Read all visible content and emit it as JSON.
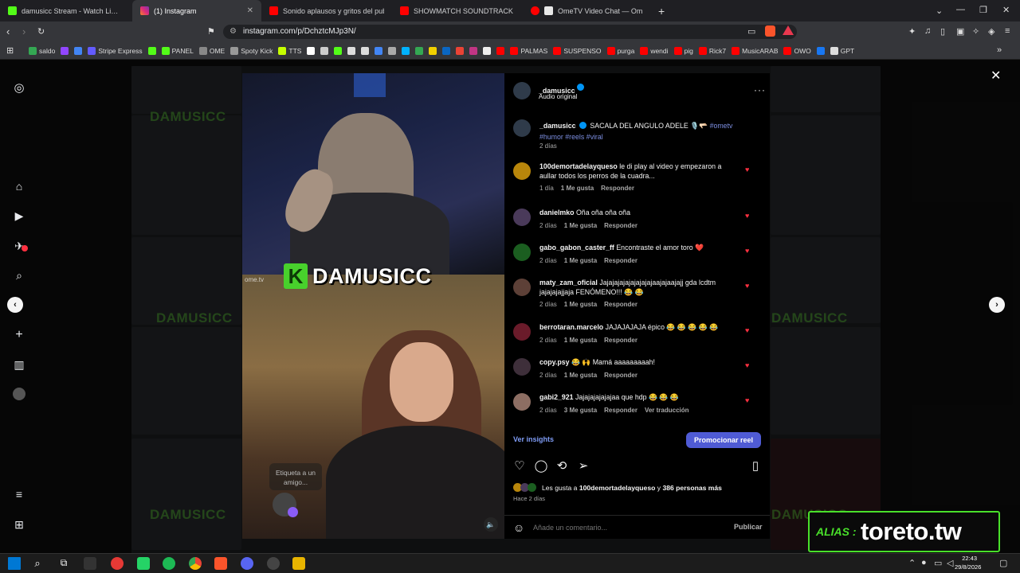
{
  "tabs": [
    {
      "title": "damusicc Stream - Watch Live on",
      "color": "#53fc18"
    },
    {
      "title": "(1) Instagram",
      "color": "#c13584",
      "active": true
    },
    {
      "title": "Sonido aplausos y gritos del publico",
      "color": "#ff0000"
    },
    {
      "title": "SHOWMATCH SOUNDTRACK - \"Risk",
      "color": "#ff0000"
    },
    {
      "title": "OmeTV Video Chat — Omegle R",
      "color": "#ff0000"
    }
  ],
  "address": {
    "url": "instagram.com/p/DchztcMJp3N/"
  },
  "bookmarks": [
    {
      "label": "saldo",
      "color": "#34a853"
    },
    {
      "label": "",
      "color": "#9146ff"
    },
    {
      "label": "",
      "color": "#4285f4"
    },
    {
      "label": "Stripe Express",
      "color": "#635bff"
    },
    {
      "label": "",
      "color": "#53fc18"
    },
    {
      "label": "PANEL",
      "color": "#53fc18"
    },
    {
      "label": "OME",
      "color": "#888888"
    },
    {
      "label": "Spoty Kick",
      "color": "#999999"
    },
    {
      "label": "TTS",
      "color": "#c6ff00"
    },
    {
      "label": "",
      "color": "#ffffff"
    },
    {
      "label": "",
      "color": "#cccccc"
    },
    {
      "label": "",
      "color": "#53fc18"
    },
    {
      "label": "",
      "color": "#dddddd"
    },
    {
      "label": "",
      "color": "#dddddd"
    },
    {
      "label": "",
      "color": "#4285f4"
    },
    {
      "label": "",
      "color": "#aaaaaa"
    },
    {
      "label": "",
      "color": "#00b2ff"
    },
    {
      "label": "",
      "color": "#34a853"
    },
    {
      "label": "",
      "color": "#f0d000"
    },
    {
      "label": "",
      "color": "#0a66c2"
    },
    {
      "label": "",
      "color": "#ea4335"
    },
    {
      "label": "",
      "color": "#c13584"
    },
    {
      "label": "",
      "color": "#eeeeee"
    },
    {
      "label": "",
      "color": "#ff0000"
    },
    {
      "label": "PALMAS",
      "color": "#ff0000"
    },
    {
      "label": "SUSPENSO",
      "color": "#ff0000"
    },
    {
      "label": "purga",
      "color": "#ff0000"
    },
    {
      "label": "wendi",
      "color": "#ff0000"
    },
    {
      "label": "pig",
      "color": "#ff0000"
    },
    {
      "label": "Rick7",
      "color": "#ff0000"
    },
    {
      "label": "MusicARAB",
      "color": "#ff0000"
    },
    {
      "label": "OWO",
      "color": "#ff0000"
    },
    {
      "label": "",
      "color": "#1877f2"
    },
    {
      "label": "GPT",
      "color": "#dddddd"
    }
  ],
  "video": {
    "brand_letter": "K",
    "brand_text": "DAMUSICC",
    "source_tag": "ome.tv",
    "tag_hint": "Etiqueta a un amigo..."
  },
  "collage_labels": [
    "DAMUSICC",
    "DAMUSICC",
    "DAMUSICC",
    "DAMUSICC",
    "DAMUSICC"
  ],
  "post": {
    "author": "_damusicc",
    "audio": "Audio original",
    "caption_user": "_damusicc",
    "caption": "SACALA DEL ANGULO ADELE 🎙️🫳🏻 ",
    "caption_tags": "#ometv #humor #reels #viral",
    "caption_time": "2 días"
  },
  "comments": [
    {
      "user": "100demortadelayqueso",
      "text": "le di play al video y empezaron a aullar todos los perros de la cuadra...",
      "time": "1 día",
      "likes": "1 Me gusta",
      "reply": "Responder",
      "avatar": "#b8860b"
    },
    {
      "user": "danielmko",
      "text": "Oña oña oña oña",
      "time": "2 días",
      "likes": "1 Me gusta",
      "reply": "Responder",
      "avatar": "#4a3a5a"
    },
    {
      "user": "gabo_gabon_caster_ff",
      "text": "Encontraste el amor toro ❤️",
      "time": "2 días",
      "likes": "1 Me gusta",
      "reply": "Responder",
      "avatar": "#1b5e20"
    },
    {
      "user": "maty_zam_oficial",
      "text": "Jajajajajajajajajajaajajaajajj gda lcdtm jajajajajjaja FENÓMENO!!! 😂 😂",
      "time": "2 días",
      "likes": "1 Me gusta",
      "reply": "Responder",
      "avatar": "#5d4037"
    },
    {
      "user": "berrotaran.marcelo",
      "text": "JAJAJAJAJA épico 😂 😂 😂 😂 😂",
      "time": "2 días",
      "likes": "1 Me gusta",
      "reply": "Responder",
      "avatar": "#6a1b2a"
    },
    {
      "user": "copy.psy",
      "text": "😂 🙌 Mamá aaaaaaaaah!",
      "time": "2 días",
      "likes": "1 Me gusta",
      "reply": "Responder",
      "avatar": "#3e2f3a"
    },
    {
      "user": "gabi2_921",
      "text": "Jajajajajajajaa que hdp 😂 😂 😂",
      "time": "2 días",
      "likes": "3 Me gusta",
      "reply": "Responder",
      "translate": "Ver traducción",
      "avatar": "#8d6e63"
    }
  ],
  "insights": "Ver insights",
  "promote": "Promocionar reel",
  "likes": {
    "prefix": "Les gusta a",
    "user": "100demortadelayqueso",
    "mid": "y",
    "others": "386 personas más"
  },
  "post_age": "Hace 2 días",
  "comment_box": {
    "placeholder": "Añade un comentario...",
    "publish": "Publicar"
  },
  "alias": {
    "label": "ALIAS :",
    "value": "toreto.tw"
  },
  "clock": {
    "time": "22:43",
    "date": "29/8/2026"
  },
  "colors": {
    "accent": "#4f5bd5",
    "link": "#e0f1ff",
    "kick": "#53fc18",
    "heart": "#ff3040",
    "tags": "#7c8ee0"
  }
}
